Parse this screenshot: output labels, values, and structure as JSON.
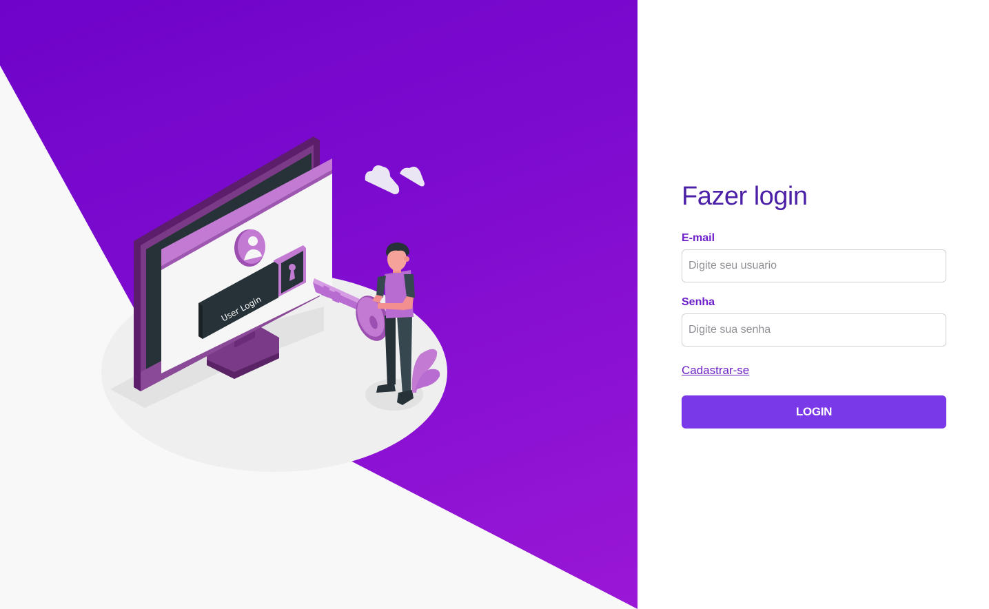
{
  "colors": {
    "hero_gradient_start": "#6f03c9",
    "hero_gradient_end": "#9a17d6",
    "title": "#4b1fa6",
    "label": "#6c1fc9",
    "button_bg": "#7a39e8",
    "button_text": "#ffffff"
  },
  "illustration": {
    "screen_label": "User Login"
  },
  "form": {
    "title": "Fazer login",
    "email": {
      "label": "E-mail",
      "placeholder": "Digite seu usuario",
      "value": ""
    },
    "password": {
      "label": "Senha",
      "placeholder": "Digite sua senha",
      "value": ""
    },
    "register_link": "Cadastrar-se",
    "submit_label": "LOGIN"
  }
}
